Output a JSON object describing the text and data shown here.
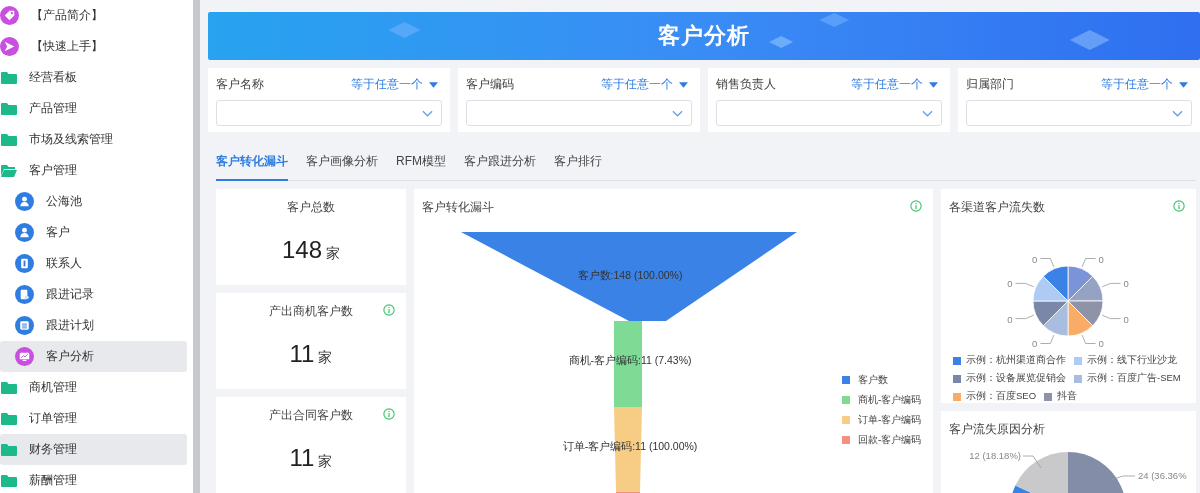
{
  "sidebar": {
    "items": [
      {
        "label": "【产品简介】",
        "kind": "tag",
        "selected": false
      },
      {
        "label": "【快速上手】",
        "kind": "send",
        "selected": false
      },
      {
        "label": "经营看板",
        "kind": "folder",
        "selected": false
      },
      {
        "label": "产品管理",
        "kind": "folder",
        "selected": false
      },
      {
        "label": "市场及线索管理",
        "kind": "folder",
        "selected": false
      },
      {
        "label": "客户管理",
        "kind": "folder-open",
        "selected": false,
        "children": [
          {
            "label": "公海池",
            "kind": "person",
            "selected": false
          },
          {
            "label": "客户",
            "kind": "person",
            "selected": false
          },
          {
            "label": "联系人",
            "kind": "contact",
            "selected": false
          },
          {
            "label": "跟进记录",
            "kind": "record",
            "selected": false
          },
          {
            "label": "跟进计划",
            "kind": "plan",
            "selected": false
          },
          {
            "label": "客户分析",
            "kind": "analysis",
            "selected": true
          }
        ]
      },
      {
        "label": "商机管理",
        "kind": "folder",
        "selected": false
      },
      {
        "label": "订单管理",
        "kind": "folder",
        "selected": false
      },
      {
        "label": "财务管理",
        "kind": "folder",
        "selected": true
      },
      {
        "label": "薪酬管理",
        "kind": "folder",
        "selected": false
      }
    ]
  },
  "banner": {
    "title": "客户分析"
  },
  "filters": [
    {
      "label": "客户名称",
      "operator": "等于任意一个"
    },
    {
      "label": "客户编码",
      "operator": "等于任意一个"
    },
    {
      "label": "销售负责人",
      "operator": "等于任意一个"
    },
    {
      "label": "归属部门",
      "operator": "等于任意一个"
    }
  ],
  "tabs": [
    {
      "label": "客户转化漏斗",
      "selected": true
    },
    {
      "label": "客户画像分析",
      "selected": false
    },
    {
      "label": "RFM模型",
      "selected": false
    },
    {
      "label": "客户跟进分析",
      "selected": false
    },
    {
      "label": "客户排行",
      "selected": false
    }
  ],
  "stats": [
    {
      "title": "客户总数",
      "value": "148",
      "unit": "家",
      "info": false
    },
    {
      "title": "产出商机客户数",
      "value": "11",
      "unit": "家",
      "info": true
    },
    {
      "title": "产出合同客户数",
      "value": "11",
      "unit": "家",
      "info": true
    }
  ],
  "funnel": {
    "title": "客户转化漏斗",
    "info": true,
    "stages": [
      {
        "label": "客户数:148 (100.00%)",
        "color": "#3b82e6"
      },
      {
        "label": "商机-客户编码:11 (7.43%)",
        "color": "#7ddb96"
      },
      {
        "label": "订单-客户编码:11 (100.00%)",
        "color": "#f7cd86"
      },
      {
        "color": "#f3907e"
      }
    ],
    "legend": [
      {
        "label": "客户数",
        "color": "#3b82e6"
      },
      {
        "label": "商机-客户编码",
        "color": "#7ddb96"
      },
      {
        "label": "订单-客户编码",
        "color": "#f7cd86"
      },
      {
        "label": "回款-客户编码",
        "color": "#f3907e"
      }
    ]
  },
  "channel_loss": {
    "title": "各渠道客户流失数",
    "info": true,
    "slices": [
      {
        "label": "0",
        "color": "#7b93d9"
      },
      {
        "label": "0",
        "color": "#94a3c4"
      },
      {
        "label": "0",
        "color": "#8f93a8"
      },
      {
        "label": "0",
        "color": "#f9ac68"
      },
      {
        "label": "0",
        "color": "#a9bde0"
      },
      {
        "label": "0",
        "color": "#7a87a8"
      },
      {
        "label": "0",
        "color": "#aecbf5"
      },
      {
        "label": "0",
        "color": "#3b82e6"
      }
    ],
    "legend": [
      {
        "label": "示例：杭州渠道商合作",
        "color": "#3b82e6"
      },
      {
        "label": "示例：线下行业沙龙",
        "color": "#aecbf5"
      },
      {
        "label": "示例：设备展览促销会",
        "color": "#7a87a8"
      },
      {
        "label": "示例：百度广告-SEM",
        "color": "#a9bde0"
      },
      {
        "label": "示例：百度SEO",
        "color": "#f9ac68"
      },
      {
        "label": "抖音",
        "color": "#8f93a8"
      }
    ]
  },
  "loss_reason": {
    "title": "客户流失原因分析",
    "labels": [
      "12 (18.18%)",
      "24 (36.36%"
    ]
  }
}
